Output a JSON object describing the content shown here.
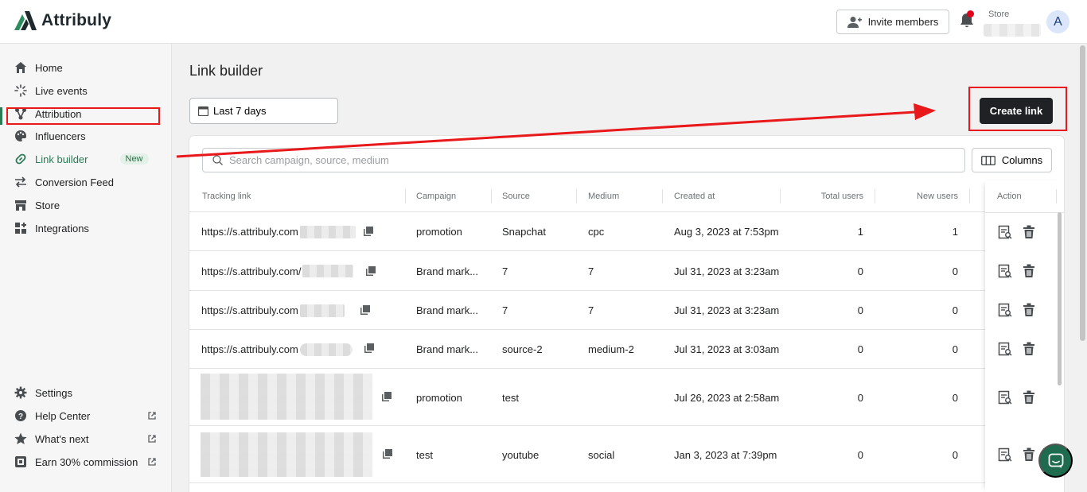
{
  "brand": {
    "name": "Attribuly"
  },
  "header": {
    "invite_label": "Invite members",
    "store_label": "Store",
    "avatar_initial": "A"
  },
  "sidebar": {
    "items": [
      {
        "label": "Home",
        "icon": "home-icon"
      },
      {
        "label": "Live events",
        "icon": "sparkle-icon"
      },
      {
        "label": "Attribution",
        "icon": "attribution-icon"
      },
      {
        "label": "Influencers",
        "icon": "palette-icon"
      },
      {
        "label": "Link builder",
        "icon": "link-icon",
        "badge": "New",
        "active": true
      },
      {
        "label": "Conversion Feed",
        "icon": "arrows-icon"
      },
      {
        "label": "Store",
        "icon": "store-icon"
      },
      {
        "label": "Integrations",
        "icon": "apps-icon"
      }
    ],
    "bottom_items": [
      {
        "label": "Settings",
        "icon": "gear-icon"
      },
      {
        "label": "Help Center",
        "icon": "help-icon",
        "external": true
      },
      {
        "label": "What's next",
        "icon": "star-icon",
        "external": true
      },
      {
        "label": "Earn 30% commission",
        "icon": "money-icon",
        "external": true
      }
    ]
  },
  "main": {
    "title": "Link builder",
    "date_range": "Last 7 days",
    "create_label": "Create link",
    "search_placeholder": "Search campaign, source, medium",
    "columns_label": "Columns",
    "headers": [
      "Tracking link",
      "Campaign",
      "Source",
      "Medium",
      "Created at",
      "Total users",
      "New users",
      "Action"
    ],
    "rows": [
      {
        "link": "https://s.attribuly.com",
        "campaign": "promotion",
        "source": "Snapchat",
        "medium": "cpc",
        "created": "Aug 3, 2023 at 7:53pm",
        "total": "1",
        "new": "1"
      },
      {
        "link": "https://s.attribuly.com/",
        "campaign": "Brand mark...",
        "source": "7",
        "medium": "7",
        "created": "Jul 31, 2023 at 3:23am",
        "total": "0",
        "new": "0"
      },
      {
        "link": "https://s.attribuly.com",
        "campaign": "Brand mark...",
        "source": "7",
        "medium": "7",
        "created": "Jul 31, 2023 at 3:23am",
        "total": "0",
        "new": "0"
      },
      {
        "link": "https://s.attribuly.com",
        "campaign": "Brand mark...",
        "source": "source-2",
        "medium": "medium-2",
        "created": "Jul 31, 2023 at 3:03am",
        "total": "0",
        "new": "0"
      },
      {
        "link": "",
        "campaign": "promotion",
        "source": "test",
        "medium": "",
        "created": "Jul 26, 2023 at 2:58am",
        "total": "0",
        "new": "0"
      },
      {
        "link": "",
        "campaign": "test",
        "source": "youtube",
        "medium": "social",
        "created": "Jan 3, 2023 at 7:39pm",
        "total": "0",
        "new": "0"
      }
    ]
  },
  "colors": {
    "accent": "#2a7a56",
    "annotation": "#e8181b",
    "primary_button": "#1f2125"
  }
}
